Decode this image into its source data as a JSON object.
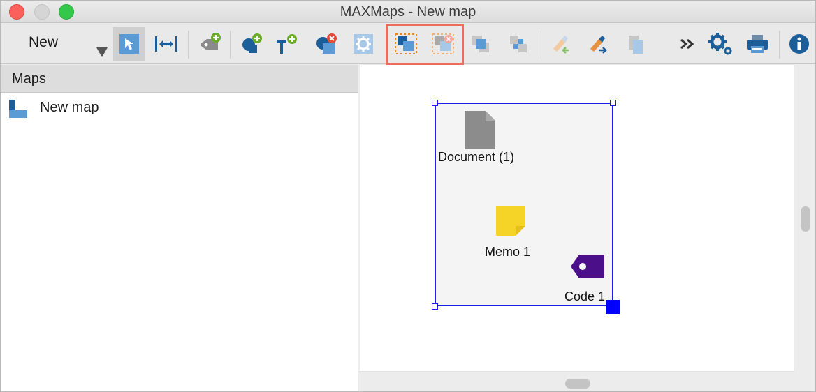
{
  "window": {
    "title": "MAXMaps - New map"
  },
  "toolbar": {
    "new_label": "New",
    "icons": {
      "select": "arrow-cursor-icon",
      "fit": "fit-width-icon",
      "add_code": "add-code-icon",
      "add_shape": "add-shape-icon",
      "add_text": "add-text-icon",
      "remove_object": "remove-object-icon",
      "settings": "gear-icon",
      "group": "group-icon",
      "ungroup": "ungroup-icon",
      "bring_front": "bring-to-front-icon",
      "send_back": "send-to-back-icon",
      "format_paste": "paint-brush-icon",
      "format_copy": "format-copy-icon",
      "copy": "copy-icon",
      "more": "double-chevron-icon",
      "options": "options-gear-icon",
      "print": "printer-icon",
      "info": "info-icon"
    },
    "colors": {
      "accent_blue": "#1b5e99",
      "light_blue": "#5b9bd5",
      "green_plus": "#6aaa2a",
      "red_x": "#e04b3a",
      "highlight": "#ea6d5e"
    }
  },
  "sidebar": {
    "header": "Maps",
    "items": [
      {
        "label": "New map",
        "icon": "map-icon"
      }
    ]
  },
  "canvas": {
    "nodes": [
      {
        "label": "Document (1)",
        "icon": "document-icon",
        "color": "#8c8c8c"
      },
      {
        "label": "Memo 1",
        "icon": "memo-icon",
        "color": "#f5d327"
      },
      {
        "label": "Code 1",
        "icon": "code-tag-icon",
        "color": "#4b0f8a"
      }
    ],
    "selection_color": "#1e1ee6"
  }
}
